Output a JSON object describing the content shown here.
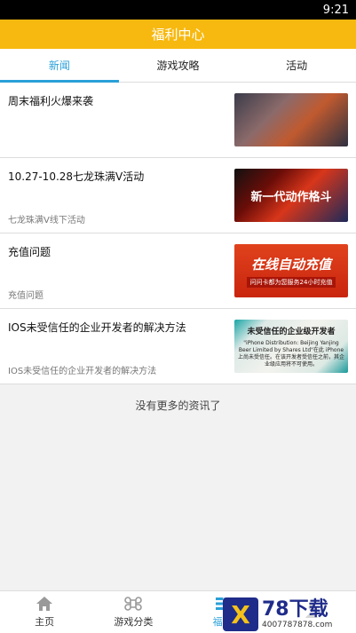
{
  "status": {
    "time": "9:21"
  },
  "header": {
    "title": "福利中心"
  },
  "tabs": [
    {
      "label": "新闻",
      "active": true
    },
    {
      "label": "游戏攻略",
      "active": false
    },
    {
      "label": "活动",
      "active": false
    }
  ],
  "news": [
    {
      "title": "周末福利火爆来袭",
      "subtitle": ""
    },
    {
      "title": "10.27-10.28七龙珠满V活动",
      "subtitle": "七龙珠满V线下活动",
      "thumb_text": "新一代动作格斗"
    },
    {
      "title": "充值问题",
      "subtitle": "充值问题",
      "thumb_text": "在线自动充值",
      "thumb_sub": "问问卡都为您服务24小时充值"
    },
    {
      "title": "IOS未受信任的企业开发者的解决方法",
      "subtitle": "IOS未受信任的企业开发者的解决方法",
      "thumb_title": "未受信任的企业级开发者",
      "thumb_body": "\"iPhone Distribution: Beijing Yanjing Beer Limited by Shares Ltd\"在此 iPhone 上尚未受信任。在该开发者受信任之前，其企业级应用将不可使用。"
    }
  ],
  "footer_note": "没有更多的资讯了",
  "bottom_nav": [
    {
      "label": "主页",
      "icon": "home-icon"
    },
    {
      "label": "游戏分类",
      "icon": "command-icon"
    },
    {
      "label": "福利",
      "icon": "list-icon",
      "active": true
    },
    {
      "label": "",
      "icon": "user-icon"
    }
  ],
  "watermark": {
    "logo": "X",
    "main": "78下载",
    "sub": "4007787878.com"
  }
}
